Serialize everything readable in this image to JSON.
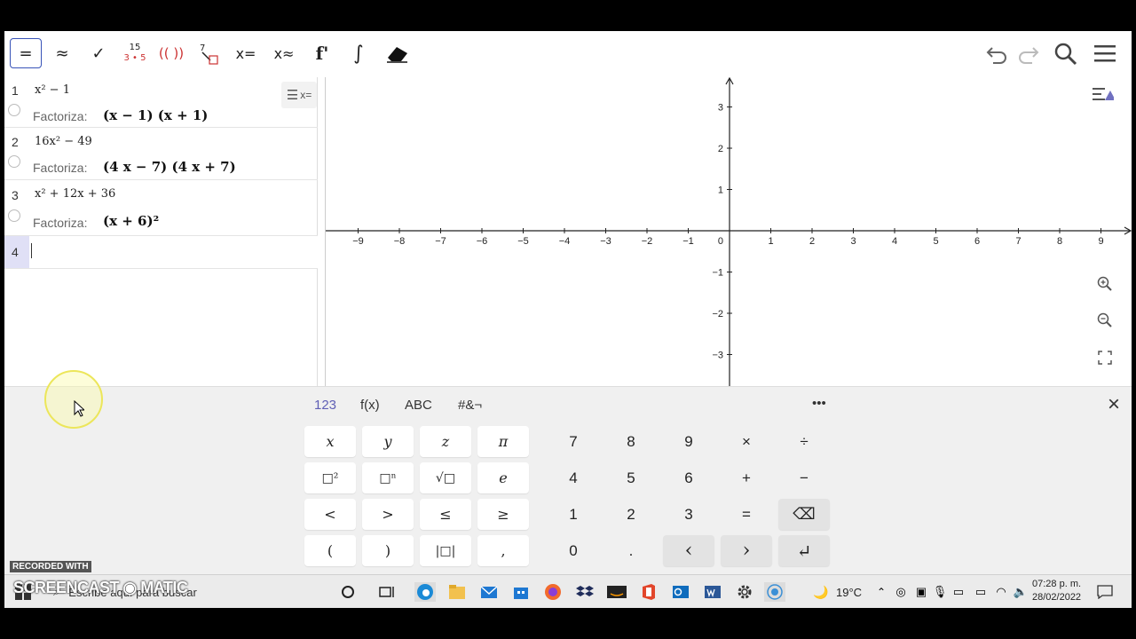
{
  "toolbar": {
    "buttons": [
      "=",
      "≈",
      "✓",
      "",
      "(( ))",
      "",
      "x=",
      "x≈",
      "f'",
      "∫",
      ""
    ],
    "fraction_top": "15",
    "fraction_bottom": "3 • 5",
    "substitute_top": "7"
  },
  "algebra": {
    "rows": [
      {
        "num": "1",
        "input": "x² − 1",
        "label": "Factoriza:",
        "output": "(x − 1) (x + 1)"
      },
      {
        "num": "2",
        "input": "16x² − 49",
        "label": "Factoriza:",
        "output": "(4 x − 7) (4 x + 7)"
      },
      {
        "num": "3",
        "input": "x² + 12x + 36",
        "label": "Factoriza:",
        "output": "(x + 6)²"
      },
      {
        "num": "4",
        "input": "",
        "label": "",
        "output": ""
      }
    ],
    "menu_label": "x="
  },
  "graph": {
    "x_ticks": [
      "−9",
      "−8",
      "−7",
      "−6",
      "−5",
      "−4",
      "−3",
      "−2",
      "−1",
      "1",
      "2",
      "3",
      "4",
      "5",
      "6",
      "7",
      "8",
      "9"
    ],
    "y_ticks": [
      "3",
      "2",
      "1",
      "−1",
      "−2",
      "−3"
    ],
    "origin_label": "0"
  },
  "keyboard": {
    "tabs": [
      "123",
      "f(x)",
      "ABC",
      "#&¬"
    ],
    "more": "•••",
    "close": "×",
    "left_keys": [
      "x",
      "y",
      "z",
      "π",
      "□²",
      "□ⁿ",
      "√□",
      "e",
      "<",
      ">",
      "≤",
      "≥",
      "(",
      ")",
      "|□|",
      ","
    ],
    "right_keys": [
      "7",
      "8",
      "9",
      "×",
      "÷",
      "4",
      "5",
      "6",
      "+",
      "−",
      "1",
      "2",
      "3",
      "=",
      "⌫",
      "0",
      ".",
      "‹",
      "›",
      "↵"
    ]
  },
  "taskbar": {
    "search_placeholder": "Escribe aquí para buscar",
    "temperature": "19°C",
    "time": "07:28 p. m.",
    "date": "28/02/2022",
    "watermark_small": "RECORDED WITH",
    "watermark_big": "SCREENCAST ◉ MATIC"
  },
  "colors": {
    "accent": "#5f5fb5",
    "active_border": "#3853b8",
    "row_highlight": "#e0e0f6"
  }
}
